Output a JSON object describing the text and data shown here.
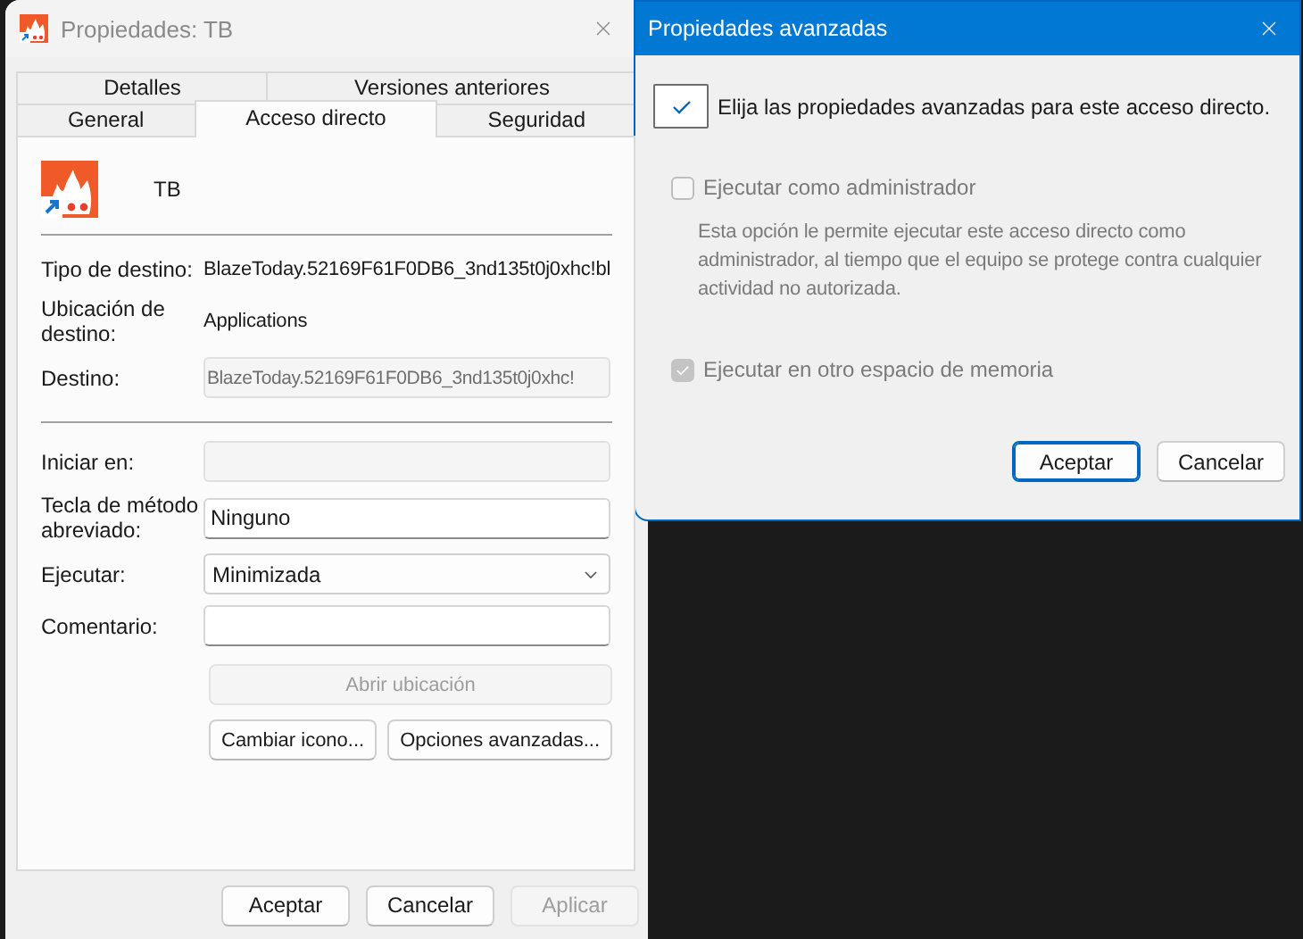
{
  "main_window": {
    "title": "Propiedades: TB",
    "active": false,
    "tab_rows": [
      [
        {
          "label": "Detalles",
          "selected": false
        },
        {
          "label": "Versiones anteriores",
          "selected": false
        }
      ],
      [
        {
          "label": "General",
          "selected": false
        },
        {
          "label": "Acceso directo",
          "selected": true
        },
        {
          "label": "Seguridad",
          "selected": false
        }
      ]
    ],
    "shortcut_name": "TB",
    "fields": [
      {
        "kind": "text",
        "label": "Tipo de destino:",
        "value": "BlazeToday.52169F61F0DB6_3nd135t0j0xhc!bl"
      },
      {
        "kind": "text",
        "label": "Ubicación de destino:",
        "value": "Applications"
      },
      {
        "kind": "input",
        "label": "Destino:",
        "value": "BlazeToday.52169F61F0DB6_3nd135t0j0xhc!",
        "disabled": true
      },
      {
        "kind": "separator"
      },
      {
        "kind": "input",
        "label": "Iniciar en:",
        "disabled": true
      },
      {
        "kind": "input",
        "label": "Tecla de método abreviado:",
        "value": "Ninguno",
        "disabled": false
      },
      {
        "kind": "select",
        "label": "Ejecutar:",
        "value": "Minimizada"
      },
      {
        "kind": "input",
        "label": "Comentario:",
        "disabled": false
      }
    ],
    "panel_buttons": [
      [
        {
          "label": "Abrir ubicación",
          "disabled": true
        }
      ],
      [
        {
          "label": "Cambiar icono...",
          "disabled": false
        },
        {
          "label": "Opciones avanzadas...",
          "disabled": false
        }
      ]
    ],
    "buttons": [
      {
        "label": "Aceptar",
        "disabled": false
      },
      {
        "label": "Cancelar",
        "disabled": false
      },
      {
        "label": "Aplicar",
        "disabled": true
      }
    ]
  },
  "advanced_dialog": {
    "title": "Propiedades avanzadas",
    "active": true,
    "options": [
      {
        "kind": "large",
        "label": "Elija las propiedades avanzadas para este acceso directo.",
        "checked": true,
        "disabled": false
      },
      {
        "kind": "normal",
        "label": "Ejecutar como administrador",
        "checked": false,
        "disabled": true,
        "description": "Esta opción le permite ejecutar este acceso directo como administrador, al tiempo que el equipo se protege contra cualquier actividad no autorizada."
      },
      {
        "kind": "normal",
        "label": "Ejecutar en otro espacio de memoria",
        "checked": true,
        "disabled": true
      }
    ],
    "buttons": [
      {
        "label": "Aceptar",
        "default": true
      },
      {
        "label": "Cancelar",
        "default": false
      }
    ]
  }
}
